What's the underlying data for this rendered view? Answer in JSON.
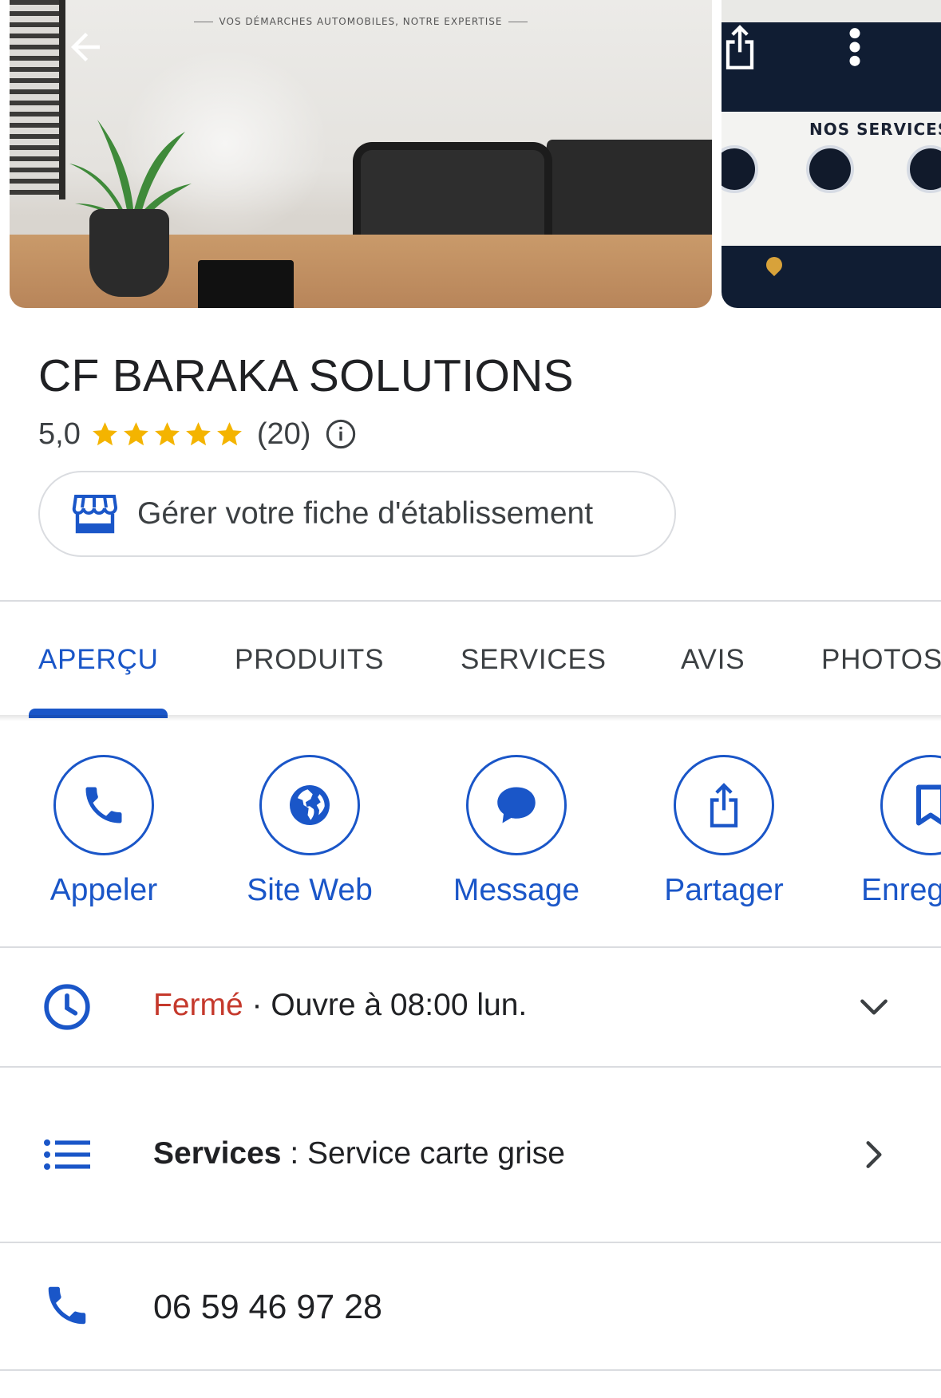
{
  "header_photos": {
    "main_tagline": "VOS DÉMARCHES AUTOMOBILES, NOTRE EXPERTISE",
    "side_heading": "NOS SERVICES"
  },
  "business": {
    "name": "CF BARAKA SOLUTIONS",
    "rating": "5,0",
    "stars": 5,
    "review_count": "(20)",
    "manage_label": "Gérer votre fiche d'établissement"
  },
  "tabs": [
    {
      "label": "APERÇU",
      "active": true
    },
    {
      "label": "PRODUITS",
      "active": false
    },
    {
      "label": "SERVICES",
      "active": false
    },
    {
      "label": "AVIS",
      "active": false
    },
    {
      "label": "PHOTOS",
      "active": false
    }
  ],
  "actions": [
    {
      "label": "Appeler",
      "icon": "phone-icon"
    },
    {
      "label": "Site Web",
      "icon": "globe-icon"
    },
    {
      "label": "Message",
      "icon": "message-icon"
    },
    {
      "label": "Partager",
      "icon": "share-icon"
    },
    {
      "label": "Enregi",
      "icon": "bookmark-icon"
    }
  ],
  "hours": {
    "status": "Fermé",
    "separator": " · ",
    "detail": "Ouvre à 08:00 lun."
  },
  "services_row": {
    "label": "Services",
    "separator": " : ",
    "value": "Service carte grise"
  },
  "phone": {
    "number": "06 59 46 97 28"
  },
  "colors": {
    "accent": "#1a56c8",
    "closed": "#c5392c",
    "star": "#f4b400",
    "divider": "#dadce0"
  }
}
